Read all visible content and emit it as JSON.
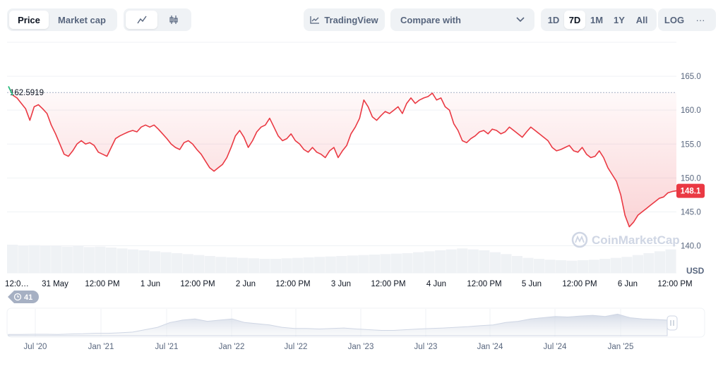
{
  "toolbar": {
    "price_label": "Price",
    "marketcap_label": "Market cap",
    "tradingview_label": "TradingView",
    "compare_placeholder": "Compare with",
    "ranges": [
      "1D",
      "7D",
      "1M",
      "1Y",
      "All"
    ],
    "active_range": "7D",
    "log_label": "LOG",
    "more_label": "···"
  },
  "chart_data": {
    "type": "line",
    "ylabel": "USD",
    "y_ticks": [
      "165.0",
      "160.0",
      "155.0",
      "150.0",
      "145.0",
      "140.0"
    ],
    "ylim": [
      136,
      170
    ],
    "x_ticks": [
      "12:0…",
      "31 May",
      "12:00 PM",
      "1 Jun",
      "12:00 PM",
      "2 Jun",
      "12:00 PM",
      "3 Jun",
      "12:00 PM",
      "4 Jun",
      "12:00 PM",
      "5 Jun",
      "12:00 PM",
      "6 Jun",
      "12:00 PM"
    ],
    "baseline_value": 162.5919,
    "baseline_label": "162.5919",
    "current_value": 148.1,
    "current_label": "148.1",
    "watermark": "CoinMarketCap",
    "series": [
      {
        "values": [
          163.5,
          162.2,
          161.8,
          161,
          160.2,
          158.5,
          160.5,
          160.8,
          160.2,
          159.5,
          157.8,
          156.5,
          155,
          153.5,
          153.2,
          154,
          155,
          155.5,
          155,
          155.2,
          154.8,
          153.8,
          153.5,
          153.2,
          154.5,
          155.8,
          156.2,
          156.5,
          156.8,
          157,
          156.8,
          157.5,
          157.8,
          157.5,
          157.8,
          157.2,
          156.5,
          155.8,
          155,
          154.5,
          154.2,
          155.2,
          155.5,
          155,
          154.2,
          153.5,
          152.5,
          151.5,
          151,
          151.5,
          152,
          153,
          154.5,
          156.2,
          157,
          156,
          154.5,
          155.5,
          156.8,
          157.5,
          157.8,
          158.8,
          157.5,
          156.2,
          155.5,
          155.8,
          156.5,
          155.5,
          155,
          154.2,
          153.8,
          154.5,
          153.8,
          153.5,
          153,
          154,
          154.5,
          153,
          154,
          154.8,
          156.5,
          157.5,
          158.8,
          161.5,
          160.5,
          159,
          158.5,
          159.2,
          159.8,
          159.5,
          160,
          160.5,
          159.5,
          161,
          161.8,
          161,
          161.5,
          161.8,
          162,
          162.5,
          161.5,
          161.8,
          160.5,
          160,
          158,
          157,
          155.5,
          155.2,
          155.8,
          156.2,
          156.8,
          157,
          156.5,
          157.2,
          157,
          156.5,
          156.8,
          157.5,
          157,
          156.5,
          156,
          156.8,
          157.5,
          157,
          156.5,
          156,
          155.5,
          154.5,
          154,
          154.2,
          154.5,
          154.8,
          154,
          153.8,
          154.5,
          153.5,
          153,
          153.2,
          154,
          153,
          151.5,
          150.5,
          149.5,
          147.5,
          144.5,
          142.8,
          143.5,
          144.5,
          145,
          145.5,
          146,
          146.5,
          147,
          147.2,
          147.8,
          148,
          148.1
        ]
      }
    ],
    "volume": [
      60,
      58,
      59,
      57,
      58,
      56,
      57,
      55,
      56,
      54,
      52,
      50,
      48,
      46,
      44,
      42,
      40,
      38,
      36,
      34,
      33,
      32,
      31,
      30,
      30,
      31,
      32,
      33,
      34,
      35,
      36,
      37,
      38,
      39,
      40,
      41,
      42,
      44,
      46,
      48,
      50,
      52,
      50,
      48,
      44,
      40,
      36,
      32,
      30,
      28,
      27,
      26,
      27,
      28,
      30,
      32,
      34,
      38,
      42,
      46,
      50
    ],
    "timeline_x_ticks": [
      "Jul '20",
      "Jan '21",
      "Jul '21",
      "Jan '22",
      "Jul '22",
      "Jan '23",
      "Jul '23",
      "Jan '24",
      "Jul '24",
      "Jan '25"
    ],
    "timeline_series": [
      0.05,
      0.05,
      0.06,
      0.06,
      0.05,
      0.07,
      0.08,
      0.1,
      0.1,
      0.12,
      0.15,
      0.25,
      0.35,
      0.55,
      0.65,
      0.7,
      0.6,
      0.65,
      0.7,
      0.55,
      0.5,
      0.45,
      0.35,
      0.3,
      0.3,
      0.28,
      0.3,
      0.32,
      0.28,
      0.25,
      0.22,
      0.22,
      0.25,
      0.28,
      0.3,
      0.32,
      0.35,
      0.38,
      0.42,
      0.45,
      0.55,
      0.6,
      0.7,
      0.75,
      0.8,
      0.78,
      0.82,
      0.85,
      0.8,
      0.9,
      0.75,
      0.7,
      0.68,
      0.65
    ]
  },
  "history_badge": "41",
  "colors": {
    "line": "#ea3943",
    "line_high": "#16c784",
    "badge_bg": "#ea3943",
    "grid": "#eff2f5",
    "axis_text": "#58667e"
  }
}
